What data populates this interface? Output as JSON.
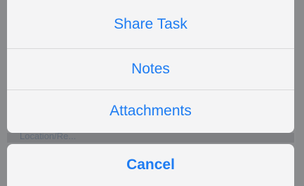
{
  "action_sheet": {
    "items": [
      {
        "label": "Share Task"
      },
      {
        "label": "Notes"
      },
      {
        "label": "Attachments"
      }
    ],
    "cancel_label": "Cancel"
  },
  "background": {
    "partial_text": "Location/Re..."
  },
  "colors": {
    "accent": "#1e7cf2",
    "sheet_bg": "#f4f4f5",
    "dim_overlay": "#8c8d8f"
  }
}
